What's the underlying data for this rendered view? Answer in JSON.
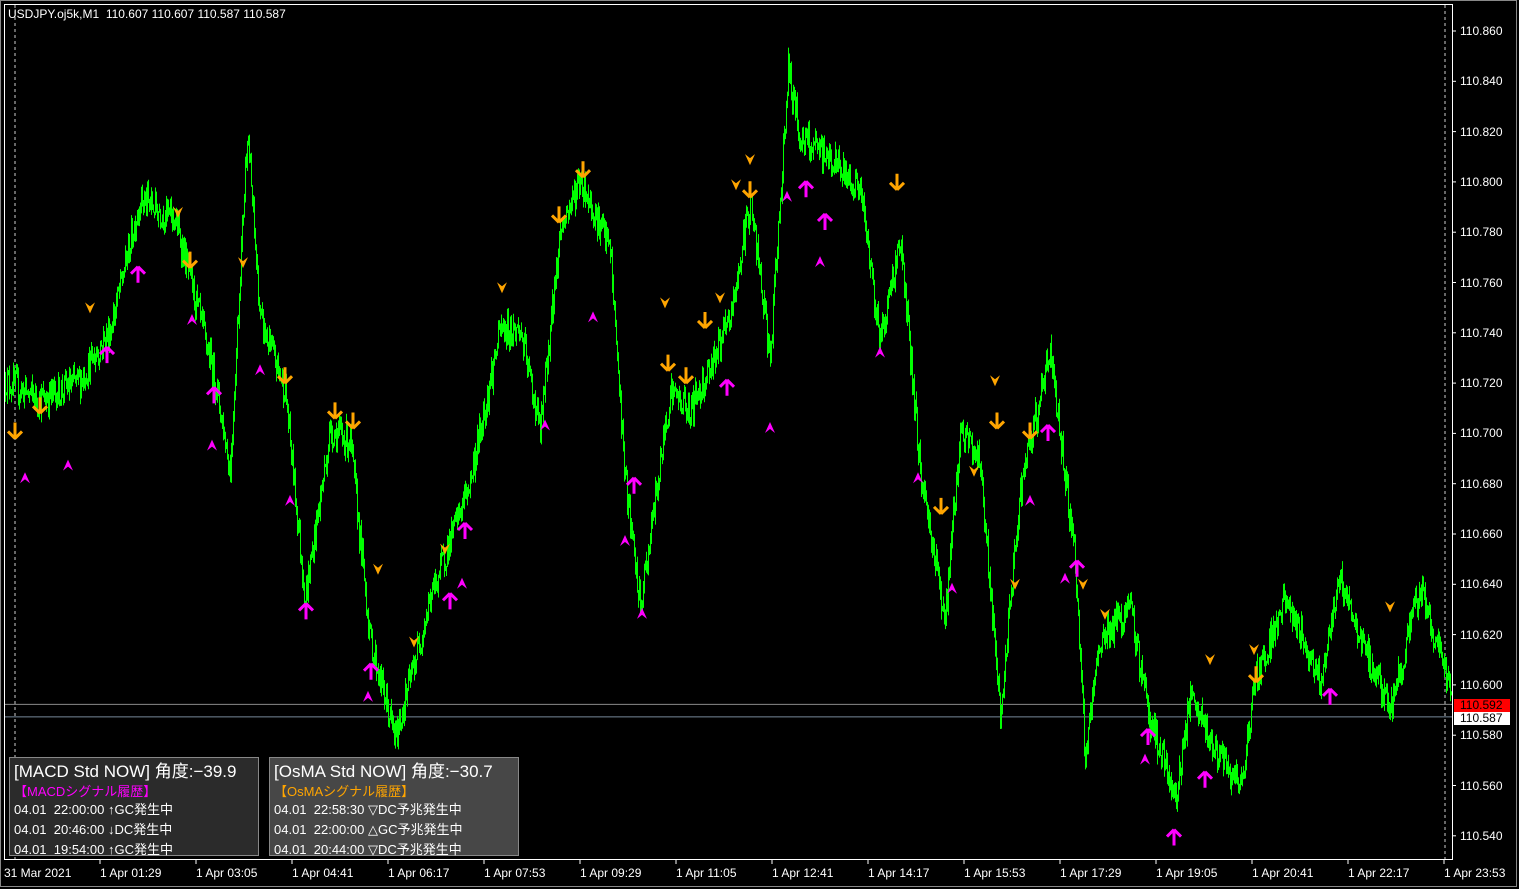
{
  "header": {
    "symbol_line": "USDJPY.oj5k,M1  110.607 110.607 110.587 110.587"
  },
  "price_axis": {
    "ticks": [
      "110.860",
      "110.840",
      "110.820",
      "110.800",
      "110.780",
      "110.760",
      "110.740",
      "110.720",
      "110.700",
      "110.680",
      "110.660",
      "110.640",
      "110.620",
      "110.600",
      "110.580",
      "110.560",
      "110.540"
    ],
    "bid_label": "110.592",
    "last_label": "110.587"
  },
  "time_axis": {
    "ticks": [
      "31 Mar 2021",
      "1 Apr 01:29",
      "1 Apr 03:05",
      "1 Apr 04:41",
      "1 Apr 06:17",
      "1 Apr 07:53",
      "1 Apr 09:29",
      "1 Apr 11:05",
      "1 Apr 12:41",
      "1 Apr 14:17",
      "1 Apr 15:53",
      "1 Apr 17:29",
      "1 Apr 19:05",
      "1 Apr 20:41",
      "1 Apr 22:17",
      "1 Apr 23:53"
    ]
  },
  "macd_panel": {
    "title": "[MACD Std NOW] 角度:−39.9",
    "subtitle": "【MACDシグナル履歴】",
    "rows": [
      "04.01  22:00:00 ↑GC発生中",
      "04.01  20:46:00 ↓DC発生中",
      "04.01  19:54:00 ↑GC発生中"
    ]
  },
  "osma_panel": {
    "title": "[OsMA Std NOW] 角度:−30.7",
    "subtitle": "【OsMAシグナル履歴】",
    "rows": [
      "04.01  22:58:30 ▽DC予兆発生中",
      "04.01  22:00:00 △GC予兆発生中",
      "04.01  20:44:00 ▽DC予兆発生中"
    ]
  },
  "colors": {
    "price_line": "#00ff00",
    "up_signal": "#ff00ff",
    "down_signal": "#ffa500",
    "bid_line": "#ff0000",
    "last_line": "#778899",
    "macd_subtitle": "#ff00ff",
    "osma_subtitle": "#ffa500"
  },
  "chart_data": {
    "type": "line",
    "title": "USDJPY.oj5k,M1",
    "ylim": [
      110.53,
      110.87
    ],
    "x_unit": "minutes from chart start",
    "series": [
      {
        "name": "price",
        "points": [
          [
            0,
            110.721
          ],
          [
            35,
            110.713
          ],
          [
            75,
            110.721
          ],
          [
            105,
            110.741
          ],
          [
            135,
            110.793
          ],
          [
            170,
            110.785
          ],
          [
            185,
            110.761
          ],
          [
            210,
            110.721
          ],
          [
            225,
            110.685
          ],
          [
            242,
            110.821
          ],
          [
            255,
            110.745
          ],
          [
            280,
            110.717
          ],
          [
            300,
            110.634
          ],
          [
            325,
            110.701
          ],
          [
            345,
            110.697
          ],
          [
            365,
            110.618
          ],
          [
            390,
            110.578
          ],
          [
            425,
            110.634
          ],
          [
            465,
            110.681
          ],
          [
            495,
            110.741
          ],
          [
            515,
            110.741
          ],
          [
            535,
            110.701
          ],
          [
            555,
            110.781
          ],
          [
            575,
            110.801
          ],
          [
            605,
            110.773
          ],
          [
            620,
            110.681
          ],
          [
            635,
            110.63
          ],
          [
            665,
            110.717
          ],
          [
            685,
            110.709
          ],
          [
            725,
            110.745
          ],
          [
            745,
            110.793
          ],
          [
            765,
            110.729
          ],
          [
            783,
            110.845
          ],
          [
            795,
            110.817
          ],
          [
            825,
            110.809
          ],
          [
            855,
            110.797
          ],
          [
            875,
            110.737
          ],
          [
            895,
            110.777
          ],
          [
            915,
            110.685
          ],
          [
            940,
            110.626
          ],
          [
            955,
            110.701
          ],
          [
            975,
            110.689
          ],
          [
            995,
            110.586
          ],
          [
            1015,
            110.677
          ],
          [
            1045,
            110.733
          ],
          [
            1070,
            110.65
          ],
          [
            1080,
            110.57
          ],
          [
            1095,
            110.618
          ],
          [
            1125,
            110.63
          ],
          [
            1145,
            110.586
          ],
          [
            1170,
            110.554
          ],
          [
            1185,
            110.594
          ],
          [
            1215,
            110.57
          ],
          [
            1235,
            110.558
          ],
          [
            1250,
            110.602
          ],
          [
            1280,
            110.634
          ],
          [
            1315,
            110.602
          ],
          [
            1335,
            110.642
          ],
          [
            1355,
            110.618
          ],
          [
            1385,
            110.59
          ],
          [
            1415,
            110.638
          ],
          [
            1445,
            110.598
          ],
          [
            1447,
            110.587
          ]
        ]
      }
    ],
    "signals": {
      "big_down": [
        [
          10,
          110.701
        ],
        [
          35,
          110.711
        ],
        [
          185,
          110.769
        ],
        [
          280,
          110.723
        ],
        [
          330,
          110.709
        ],
        [
          348,
          110.705
        ],
        [
          578,
          110.805
        ],
        [
          554,
          110.787
        ],
        [
          663,
          110.728
        ],
        [
          681,
          110.723
        ],
        [
          700,
          110.745
        ],
        [
          745,
          110.797
        ],
        [
          892,
          110.8
        ],
        [
          936,
          110.671
        ],
        [
          992,
          110.705
        ],
        [
          1025,
          110.701
        ],
        [
          1251,
          110.604
        ]
      ],
      "big_up": [
        [
          102,
          110.731
        ],
        [
          133,
          110.763
        ],
        [
          209,
          110.715
        ],
        [
          301,
          110.629
        ],
        [
          366,
          110.605
        ],
        [
          445,
          110.633
        ],
        [
          460,
          110.661
        ],
        [
          629,
          110.679
        ],
        [
          722,
          110.718
        ],
        [
          801,
          110.797
        ],
        [
          820,
          110.784
        ],
        [
          1043,
          110.7
        ],
        [
          1072,
          110.646
        ],
        [
          1143,
          110.579
        ],
        [
          1200,
          110.562
        ],
        [
          1169,
          110.539
        ],
        [
          1325,
          110.595
        ]
      ],
      "small_up": [
        [
          20,
          110.682
        ],
        [
          63,
          110.687
        ],
        [
          187,
          110.745
        ],
        [
          207,
          110.695
        ],
        [
          255,
          110.725
        ],
        [
          285,
          110.673
        ],
        [
          363,
          110.595
        ],
        [
          457,
          110.64
        ],
        [
          540,
          110.703
        ],
        [
          588,
          110.746
        ],
        [
          620,
          110.657
        ],
        [
          637,
          110.628
        ],
        [
          765,
          110.702
        ],
        [
          782,
          110.794
        ],
        [
          815,
          110.768
        ],
        [
          875,
          110.732
        ],
        [
          913,
          110.682
        ],
        [
          947,
          110.638
        ],
        [
          1025,
          110.673
        ],
        [
          1060,
          110.642
        ],
        [
          1140,
          110.57
        ]
      ],
      "small_down": [
        [
          85,
          110.75
        ],
        [
          173,
          110.788
        ],
        [
          238,
          110.768
        ],
        [
          373,
          110.646
        ],
        [
          409,
          110.617
        ],
        [
          440,
          110.654
        ],
        [
          497,
          110.758
        ],
        [
          660,
          110.752
        ],
        [
          715,
          110.754
        ],
        [
          731,
          110.799
        ],
        [
          745,
          110.809
        ],
        [
          990,
          110.721
        ],
        [
          969,
          110.685
        ],
        [
          1010,
          110.64
        ],
        [
          1078,
          110.64
        ],
        [
          1100,
          110.628
        ],
        [
          1205,
          110.61
        ],
        [
          1249,
          110.614
        ],
        [
          1385,
          110.631
        ]
      ]
    },
    "hlines": {
      "bid": 110.592,
      "last": 110.587
    }
  }
}
